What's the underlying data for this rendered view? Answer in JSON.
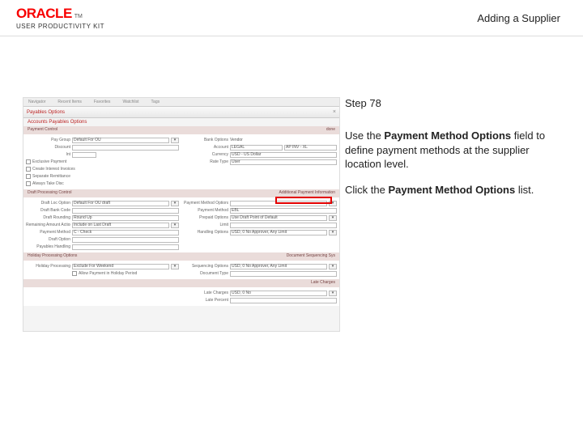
{
  "header": {
    "logo_text": "ORACLE",
    "tm": "TM",
    "upk": "USER PRODUCTIVITY KIT",
    "page_title": "Adding a Supplier"
  },
  "instruction": {
    "step": "Step 78",
    "p1_a": "Use the ",
    "p1_b": "Payment Method Options",
    "p1_c": " field to define payment methods at the supplier location level.",
    "p2_a": "Click the ",
    "p2_b": "Payment Method Options",
    "p2_c": " list."
  },
  "mock": {
    "tabs": {
      "a": "Navigator",
      "b": "Recent Items",
      "c": "Favorites",
      "d": "Watchlist",
      "e": "Tags"
    },
    "window_title": "Payables Options",
    "closex": "×",
    "subtitle": "Accounts Payables Options",
    "sec1": {
      "left": "Payment Control",
      "right": "done"
    },
    "pay_group_lbl": "Pay Group",
    "pay_group_val": "Default For OU",
    "discount_lbl": "Discount",
    "discount_val": "",
    "int_lbl": "Int",
    "int_val": "",
    "chk1": "Exclusive Payment",
    "chk2": "Create Interest Invoices",
    "chk3": "Separate Remittance",
    "chk4": "Always Take Disc",
    "bank_opt_lbl": "Bank Options",
    "bank_opt_val": "Vendor",
    "acct_lbl": "Account",
    "acct_val": "LEGAL",
    "acct_val2": "AP INV - XL",
    "currency_lbl": "Currency",
    "currency_val": "USD - US Dollar",
    "rate_type_lbl": "Rate Type",
    "rate_type_val": "User",
    "sec2": {
      "left": "Draft Processing Control",
      "right": "Additional Payment Information"
    },
    "draft_loc_lbl": "Draft Loc Option",
    "draft_loc_val": "Default For OU draft",
    "draft_bank_lbl": "Draft Bank Code",
    "draft_bank_val": "",
    "draft_rounding_lbl": "Draft Rounding",
    "draft_rounding_val": "Round Up",
    "remain_lbl": "Remaining Amount Action",
    "remain_val": "Include on Last Draft",
    "pay_method_lbl": "Payment Method",
    "pay_method_val": "C - Check",
    "draft_opt_lbl": "Draft Option",
    "draft_opt_val": "",
    "pay_handling_lbl": "Payables Handling",
    "pay_handling_val": "",
    "pmo_lbl": "Payment Method Options",
    "pmo_val": "",
    "pay_method2_lbl": "Payment Method",
    "pay_method2_val": "EBL",
    "prepay_lbl": "Prepaid Options",
    "prepay_val": "Use Draft Point of Default",
    "limit_lbl": "Limit",
    "limit_val": "",
    "handling_lbl": "Handling Options",
    "handling_val": "USD, 0 No Approver, Any Limit",
    "handling_dd": "▾",
    "sec3": {
      "left": "Holiday Processing Options",
      "right": "Document Sequencing Sys"
    },
    "holiday_lbl": "Holiday Processing",
    "holiday_val": "Exclude For Weekend",
    "hol_chk": "Allow Payment in Holiday Period",
    "seq_lbl": "Sequencing Options",
    "seq_val": "USD, 0 No Approver, Any Limit",
    "doc_type_lbl": "Document Type",
    "doc_type_val": "",
    "sec4": "Late Charges",
    "late_lbl": "Late Charges",
    "late_val": "USD, 0 No",
    "late_per_lbl": "Late Percent",
    "late_per_val": ""
  }
}
